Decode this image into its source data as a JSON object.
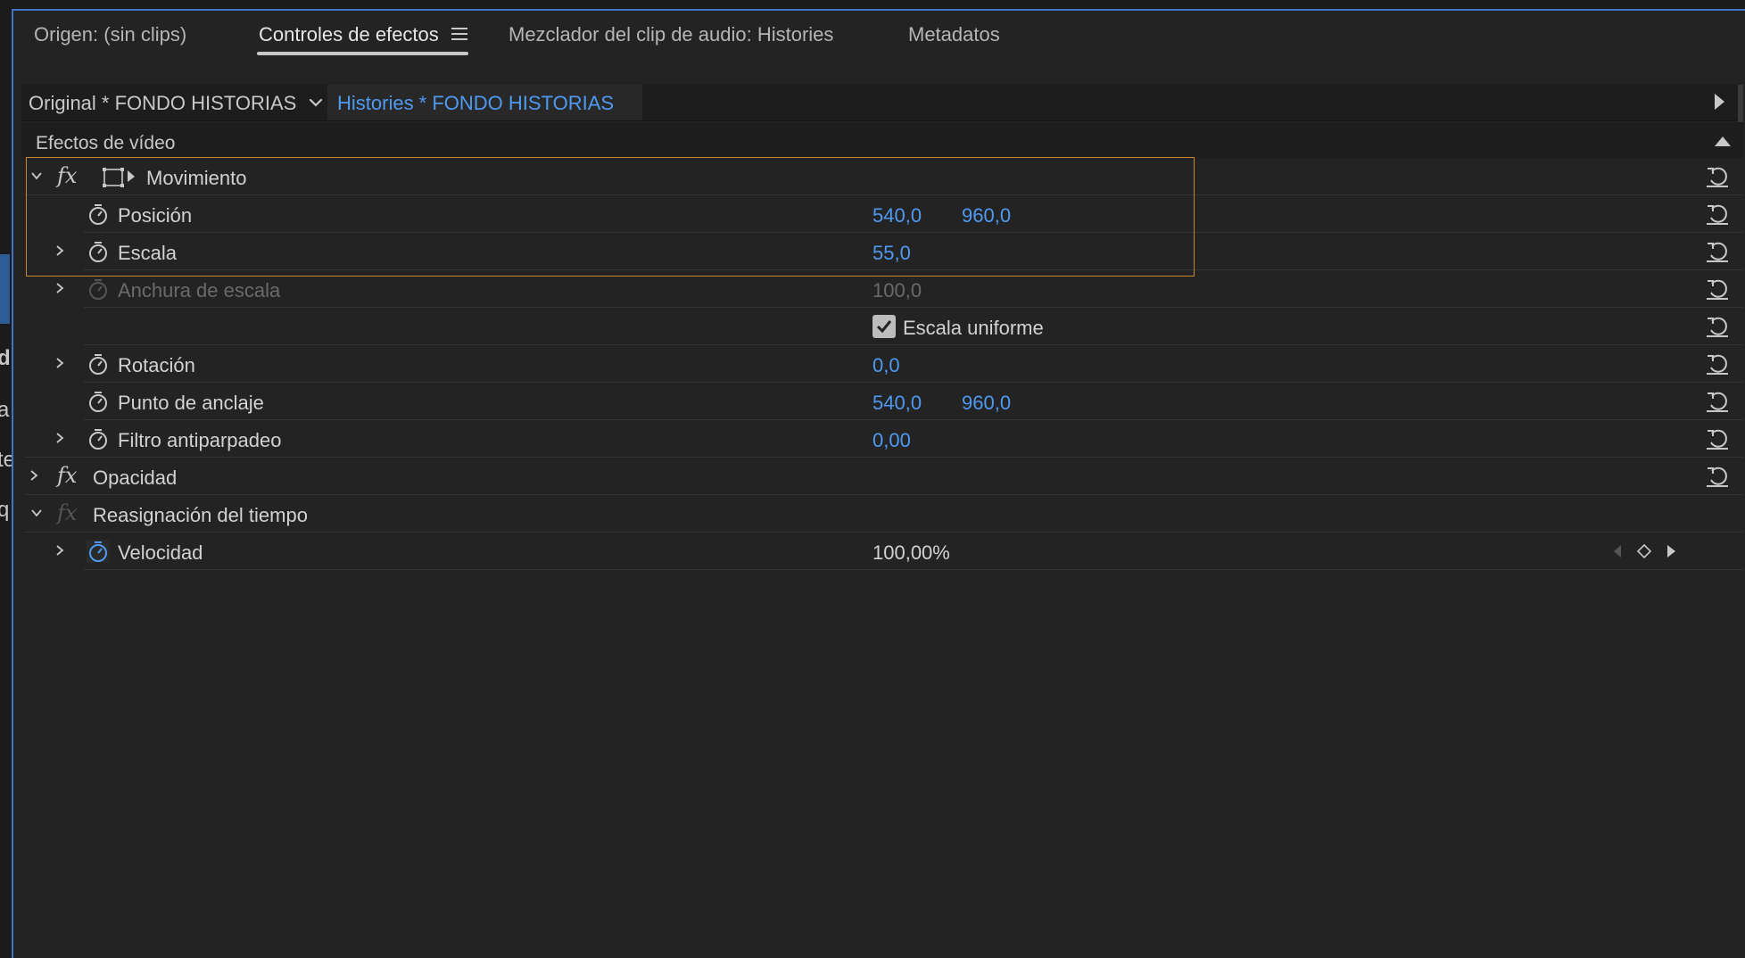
{
  "tabs": [
    {
      "label": "Origen: (sin clips)"
    },
    {
      "label": "Controles de efectos"
    },
    {
      "label": "Mezclador del clip de audio: Histories"
    },
    {
      "label": "Metadatos"
    }
  ],
  "clip": {
    "original": "Original * FONDO HISTORIAS",
    "active": "Histories * FONDO HISTORIAS"
  },
  "section": {
    "label": "Efectos de vídeo"
  },
  "effects": {
    "movimiento": {
      "label": "Movimiento"
    },
    "posicion": {
      "label": "Posición",
      "x": "540,0",
      "y": "960,0"
    },
    "escala": {
      "label": "Escala",
      "value": "55,0"
    },
    "anchura": {
      "label": "Anchura de escala",
      "value": "100,0"
    },
    "uniforme": {
      "label": "Escala uniforme",
      "checked": true
    },
    "rotacion": {
      "label": "Rotación",
      "value": "0,0"
    },
    "anclaje": {
      "label": "Punto de anclaje",
      "x": "540,0",
      "y": "960,0"
    },
    "antiparpadeo": {
      "label": "Filtro antiparpadeo",
      "value": "0,00"
    },
    "opacidad": {
      "label": "Opacidad"
    },
    "reasignacion": {
      "label": "Reasignación del tiempo"
    },
    "velocidad": {
      "label": "Velocidad",
      "value": "100,00%"
    }
  },
  "left_edge_letters": [
    "d",
    "a",
    "te",
    "q"
  ],
  "colors": {
    "accent_blue": "#4f9af0",
    "highlight_orange": "#c8862e",
    "panel_border": "#3e74c4"
  }
}
